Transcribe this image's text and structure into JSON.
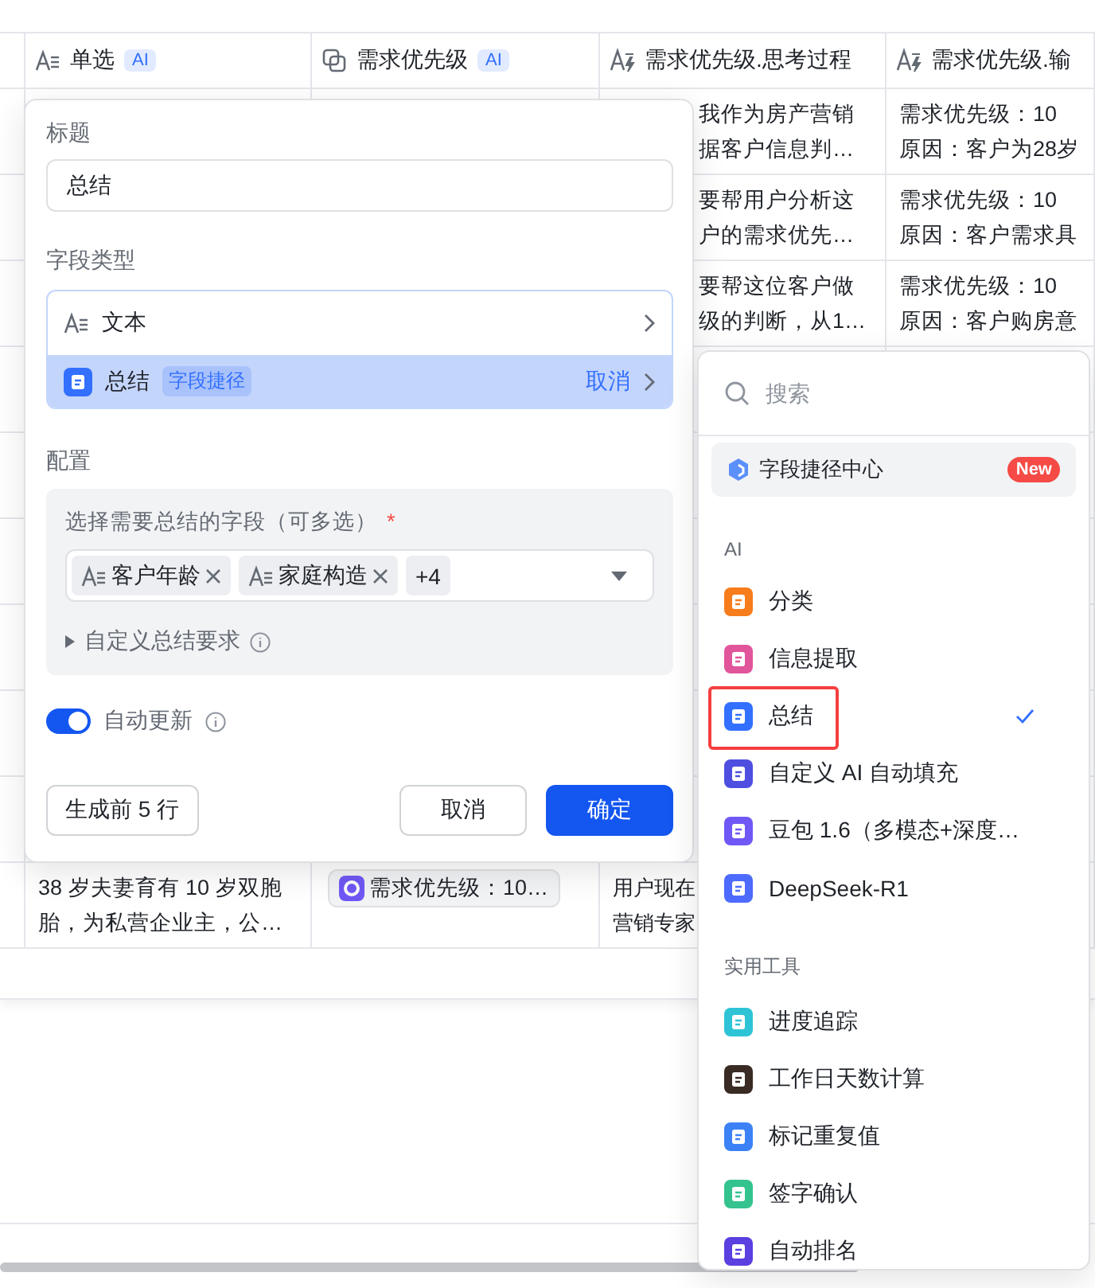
{
  "table": {
    "columns": [
      {
        "kind": "text",
        "label": "单选",
        "badge": "AI"
      },
      {
        "kind": "shortcut",
        "label": "需求优先级",
        "badge": "AI"
      },
      {
        "kind": "ai-text",
        "label": "需求优先级.思考过程"
      },
      {
        "kind": "ai-text",
        "label": "需求优先级.输"
      }
    ],
    "top_rows": [
      {
        "thinking": [
          "我作为房产营销",
          "据客户信息判…"
        ],
        "output": [
          "需求优先级：10",
          "原因：客户为28岁"
        ]
      },
      {
        "thinking": [
          "要帮用户分析这",
          "户的需求优先…"
        ],
        "output": [
          "需求优先级：10",
          "原因：客户需求具"
        ]
      },
      {
        "thinking": [
          "要帮这位客户做",
          "级的判断，从1…"
        ],
        "output": [
          "需求优先级：10",
          "原因：客户购房意"
        ]
      }
    ],
    "bottom_row": {
      "single": [
        "38 岁夫妻育有 10 岁双胞",
        "胎，为私营企业主，公…"
      ],
      "priority_chip": "需求优先级：10…",
      "thinking": [
        "用户现在",
        "营销专家"
      ]
    }
  },
  "field_dialog": {
    "title_label": "标题",
    "title_value": "总结",
    "type_label": "字段类型",
    "type_options": [
      {
        "kind": "basic",
        "label": "文本",
        "selected": false
      },
      {
        "kind": "shortcut",
        "label": "总结",
        "tag": "字段捷径",
        "action": "取消",
        "selected": true
      }
    ],
    "config_label": "配置",
    "fields_label": "选择需要总结的字段（可多选）",
    "required_mark": "*",
    "chosen_fields": [
      {
        "label": "客户年龄"
      },
      {
        "label": "家庭构造"
      }
    ],
    "more_count": "+4",
    "custom_prompt": {
      "label": "自定义总结要求",
      "expanded": false
    },
    "auto_update": {
      "label": "自动更新",
      "on": true
    },
    "buttons": [
      {
        "kind": "secondary",
        "label": "生成前 5 行"
      },
      {
        "kind": "secondary",
        "label": "取消"
      },
      {
        "kind": "primary",
        "label": "确定"
      }
    ]
  },
  "type_menu": {
    "search": {
      "placeholder": "搜索"
    },
    "featured": {
      "label": "字段捷径中心",
      "badge": "New"
    },
    "sections": [
      {
        "heading": "AI",
        "items": [
          {
            "label": "分类",
            "color": "#f77c1c",
            "selected": false,
            "highlighted": false
          },
          {
            "label": "信息提取",
            "color": "#e1559b",
            "selected": false,
            "highlighted": false
          },
          {
            "label": "总结",
            "color": "#3370ff",
            "selected": true,
            "highlighted": true
          },
          {
            "label": "自定义 AI 自动填充",
            "color": "#4e4fe0",
            "selected": false,
            "highlighted": false
          },
          {
            "label": "豆包 1.6（多模态+深度…",
            "color": "#6f58f5",
            "selected": false,
            "highlighted": false
          },
          {
            "label": "DeepSeek-R1",
            "color": "#4d6bfe",
            "selected": false,
            "highlighted": false
          }
        ]
      },
      {
        "heading": "实用工具",
        "items": [
          {
            "label": "进度追踪",
            "color": "#2ec4d6",
            "selected": false,
            "highlighted": false
          },
          {
            "label": "工作日天数计算",
            "color": "#3a2a24",
            "selected": false,
            "highlighted": false
          },
          {
            "label": "标记重复值",
            "color": "#3c82f6",
            "selected": false,
            "highlighted": false
          },
          {
            "label": "签字确认",
            "color": "#34c38f",
            "selected": false,
            "highlighted": false
          },
          {
            "label": "自动排名",
            "color": "#5b3fe0",
            "selected": false,
            "highlighted": false
          }
        ]
      }
    ]
  }
}
